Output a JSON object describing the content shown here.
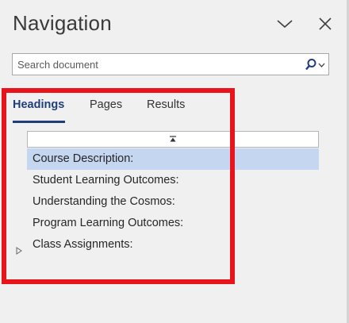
{
  "header": {
    "title": "Navigation",
    "options_icon": "chevron-down-icon",
    "close_icon": "close-icon"
  },
  "search": {
    "placeholder": "Search document",
    "value": "",
    "icon": "search-icon"
  },
  "tabs": [
    {
      "label": "Headings",
      "active": true
    },
    {
      "label": "Pages",
      "active": false
    },
    {
      "label": "Results",
      "active": false
    }
  ],
  "headings": [
    {
      "label": "Course Description:",
      "selected": true,
      "expandable": false
    },
    {
      "label": "Student Learning Outcomes:",
      "selected": false,
      "expandable": false
    },
    {
      "label": "Understanding the Cosmos:",
      "selected": false,
      "expandable": false
    },
    {
      "label": "Program Learning Outcomes:",
      "selected": false,
      "expandable": false
    },
    {
      "label": "Class Assignments:",
      "selected": false,
      "expandable": true
    }
  ],
  "colors": {
    "accent": "#1f3f7a",
    "selection": "#c5d6f0",
    "highlight": "#e8141c",
    "pane_background": "#f0f0f0"
  }
}
